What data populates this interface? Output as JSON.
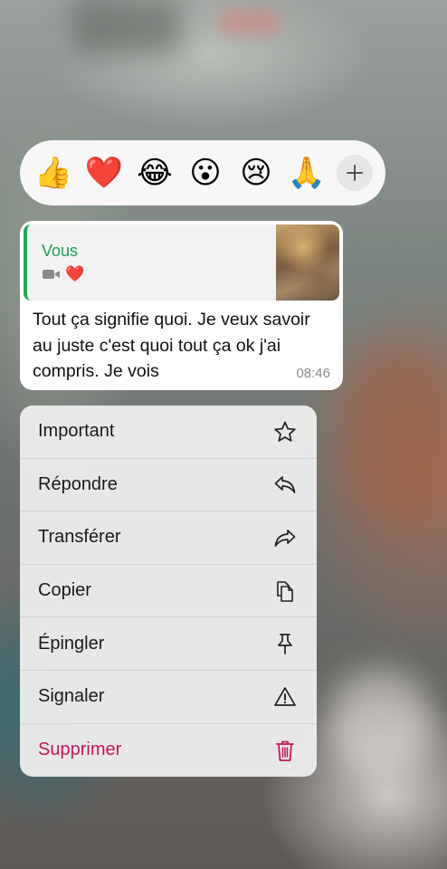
{
  "reactions": {
    "items": [
      {
        "emoji": "👍",
        "name": "thumbs-up"
      },
      {
        "emoji": "❤️",
        "name": "red-heart"
      },
      {
        "emoji": "😂",
        "name": "tears-of-joy"
      },
      {
        "emoji": "😮",
        "name": "surprised"
      },
      {
        "emoji": "😢",
        "name": "crying"
      },
      {
        "emoji": "🙏",
        "name": "folded-hands"
      }
    ],
    "more_icon": "plus-icon"
  },
  "message": {
    "quote": {
      "author": "Vous",
      "media_icon": "video-camera-icon",
      "reaction": "❤️",
      "thumbnail": "video-thumbnail"
    },
    "text": "Tout ça signifie quoi. Je veux savoir au juste c'est quoi tout ça ok j'ai compris. Je vois",
    "time": "08:46"
  },
  "menu": {
    "items": [
      {
        "label": "Important",
        "icon": "star-icon"
      },
      {
        "label": "Répondre",
        "icon": "reply-icon"
      },
      {
        "label": "Transférer",
        "icon": "forward-icon"
      },
      {
        "label": "Copier",
        "icon": "copy-icon"
      },
      {
        "label": "Épingler",
        "icon": "pin-icon"
      },
      {
        "label": "Signaler",
        "icon": "warning-icon"
      },
      {
        "label": "Supprimer",
        "icon": "trash-icon"
      }
    ]
  },
  "colors": {
    "accent_green": "#25a859",
    "danger": "#c2185b"
  }
}
